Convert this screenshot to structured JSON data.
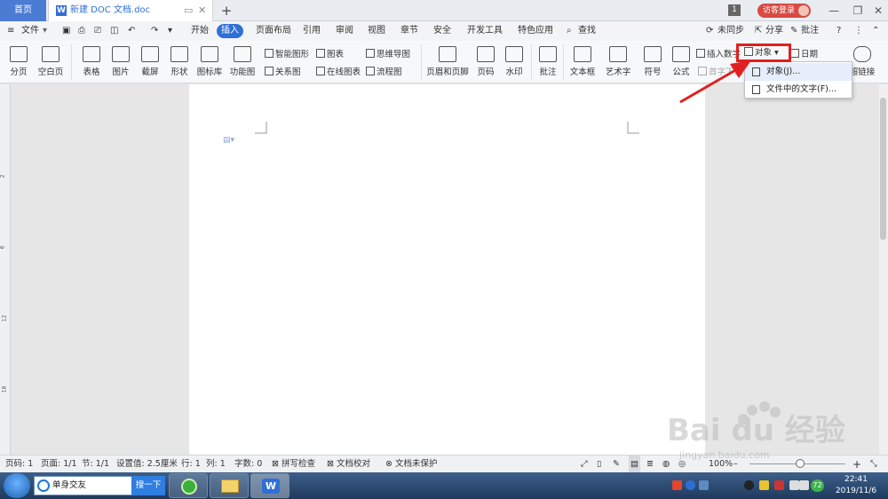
{
  "tabbar": {
    "home_tab": "首页",
    "doc_tab": "新建 DOC 文档.doc",
    "add_tab": "+",
    "window_count": "1",
    "visitor_login": "访客登录"
  },
  "menubar": {
    "file": "文件",
    "tabs": [
      "开始",
      "插入",
      "页面布局",
      "引用",
      "审阅",
      "视图",
      "章节",
      "安全",
      "开发工具",
      "特色应用"
    ],
    "search": "查找",
    "not_synced": "未同步",
    "share": "分享",
    "annotate": "批注"
  },
  "ribbon": {
    "page_break": "分页",
    "blank_page": "空白页",
    "table": "表格",
    "picture": "图片",
    "screenshot": "截屏",
    "shape": "形状",
    "icon_lib": "图标库",
    "func_chart": "功能图",
    "smart_shape": "智能图形",
    "chart": "图表",
    "mind_map": "思维导图",
    "relation_chart": "关系图",
    "online_chart": "在线图表",
    "flowchart": "流程图",
    "header_footer": "页眉和页脚",
    "page_number": "页码",
    "watermark": "水印",
    "comment": "批注",
    "textbox": "文本框",
    "wordart": "艺术字",
    "symbol": "符号",
    "formula": "公式",
    "insert_number": "插入数字",
    "object": "对象",
    "date": "日期",
    "drop_cap": "首字下沉",
    "hyperlink": "超链接"
  },
  "dropdown": {
    "items": [
      "对象(J)...",
      "文件中的文字(F)..."
    ]
  },
  "statusbar": {
    "page_code": "页码: 1",
    "pages": "页面: 1/1",
    "section": "节: 1/1",
    "setting": "设置值: 2.5厘米",
    "row": "行: 1",
    "col": "列: 1",
    "words": "字数: 0",
    "spell_check": "拼写检查",
    "doc_check": "文档校对",
    "protect": "文档未保护",
    "zoom": "100%"
  },
  "taskbar": {
    "search_text": "单身交友",
    "search_button": "搜一下",
    "tray_number": "72",
    "time": "22:41",
    "date": "2019/11/6"
  },
  "watermark": {
    "brand": "Bai du 经验",
    "url": "jingyan.baidu.com"
  },
  "colors": {
    "accent": "#2f6fd6",
    "highlight_red": "#e02020",
    "home_tab": "#4b7bd3"
  }
}
